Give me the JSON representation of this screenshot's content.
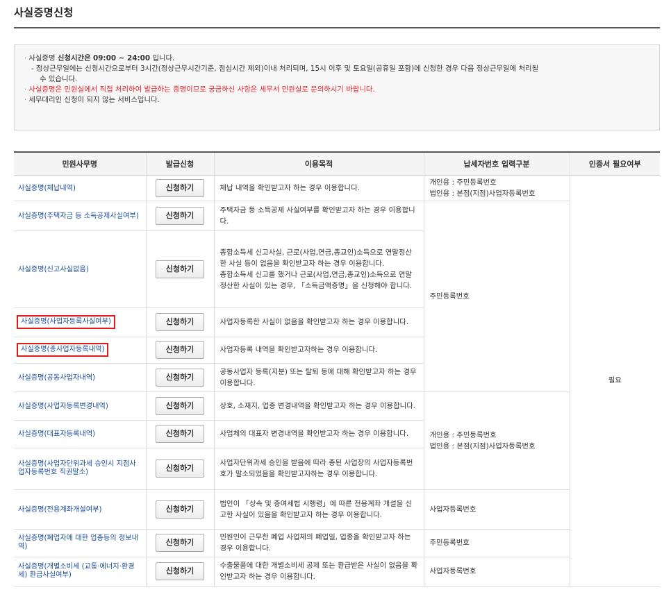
{
  "page_title": "사실증명신청",
  "notice": {
    "line1_pre": "사실증명 ",
    "line1_bold1": "신청시간은",
    "line1_mid": " ",
    "line1_bold2": "09:00 ~ 24:00",
    "line1_post": " 입니다.",
    "line2": "- 정상근무일에는 신청시간으로부터 3시간(정상근무시간기준, 점심시간 제외)이내 처리되며, 15시 이후 및 토요일(공휴일 포함)에 신청한 경우 다음 정상근무일에 처리될",
    "line2b": "수 있습니다.",
    "line3": "사실증명은 민원실에서 직접 처리하여 발급하는 증명이므로 궁금하신 사항은 세무서 민원실로 문의하시기 바랍니다.",
    "line4": "세무대리인 신청이 되지 않는 서비스입니다."
  },
  "table": {
    "headers": [
      "민원사무명",
      "발급신청",
      "이용목적",
      "납세자번호 입력구분",
      "인증서 필요여부"
    ],
    "apply_label": "신청하기",
    "cert_required": "필요",
    "rows": [
      {
        "name": "사실증명(체납내역)",
        "purpose": "체납 내역을 확인받고자 하는 경우 이용합니다."
      },
      {
        "name": "사실증명(주택자금 등 소득공제사실여부)",
        "purpose": "주택자금 등 소득공제 사실여부를 확인받고자 하는 경우 이용합니다."
      },
      {
        "name": "사실증명(신고사실없음)",
        "purpose": "종합소득세 신고사실, 근로(사업,연금,종교인)소득으로 연말정산한 사실 등이 없음을 확인받고자 하는 경우 이용합니다.\n종합소득세 신고를 했거나 근로(사업,연금,종교인)소득으로 연말정산한 사실이 있는 경우, 「소득금액증명」을 신청해야 합니다."
      },
      {
        "name": "사실증명(사업자등록사실여부)",
        "purpose": "사업자등록한 사실이 없음을 확인받고자 하는 경우 이용합니다."
      },
      {
        "name": "사실증명(총사업자등록내역)",
        "purpose": "사업자등록 내역을 확인받고자하는 경우 이용합니다."
      },
      {
        "name": "사실증명(공동사업자내역)",
        "purpose": "공동사업자 등록(지분) 또는 탈퇴 등에 대해 확인받고자 하는 경우 이용합니다."
      },
      {
        "name": "사실증명(사업자등록변경내역)",
        "purpose": "상호, 소재지, 업종 변경내역을 확인받고자 하는 경우 이용합니다."
      },
      {
        "name": "사실증명(대표자등록내역)",
        "purpose": "사업체의 대표자 변경내역을 확인받고자 하는 경우 이용합니다."
      },
      {
        "name": "사실증명(사업자단위과세 승인시 지점사업자등록번호 직권말소)",
        "purpose": "사업자단위과세 승인을 받음에 따라 종된 사업장의 사업자등록번호가 말소되었음을 확인받고자하는 경우 이용합니다."
      },
      {
        "name": "사실증명(전용계좌개설여부)",
        "purpose": "법인이 「상속 및 증여세법 시행령」에 따른 전용계좌 개설을 신고한 사실이 있음을 확인받고자 하는 경우 이용합니다."
      },
      {
        "name": "사실증명(폐업자에 대한 업종등의 정보내역)",
        "purpose": "민원인이 근무한 폐업 사업체의 폐업일, 업종을 확인받고자 하는 경우 이용합니다."
      },
      {
        "name": "사실증명(개별소비세 (교통·에너지·환경세) 환급사실여부)",
        "purpose": "수출물품에 대한 개별소비세 공제 또는 환급받은 사실이 없음을 확인받고자 하는 경우 이용합니다."
      }
    ],
    "input_groups": [
      {
        "text": "개인용 : 주민등록번호\n법인용 : 본점(지점)사업자등록번호"
      },
      {
        "text": "주민등록번호"
      },
      {
        "text": "개인용 : 주민등록번호\n법인용 : 본점(지점)사업자등록번호"
      },
      {
        "text": "사업자등록번호"
      },
      {
        "text": "주민등록번호"
      },
      {
        "text": "사업자등록번호"
      }
    ]
  }
}
